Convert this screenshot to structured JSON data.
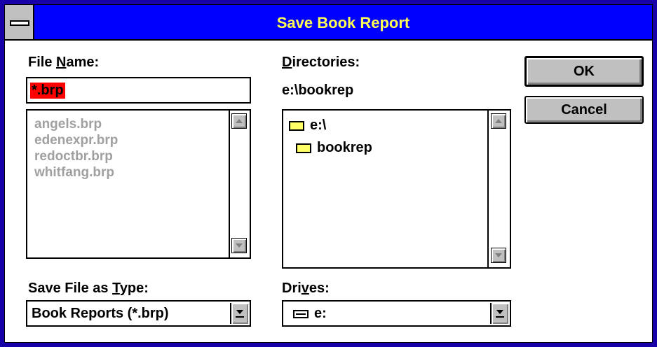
{
  "window": {
    "title": "Save Book Report"
  },
  "file_name": {
    "label_pre": "File ",
    "label_ul": "N",
    "label_post": "ame:",
    "value": "*.brp",
    "files": [
      "angels.brp",
      "edenexpr.brp",
      "redoctbr.brp",
      "whitfang.brp"
    ]
  },
  "directories": {
    "label_ul": "D",
    "label_post": "irectories:",
    "current_path": "e:\\bookrep",
    "items": [
      "e:\\",
      "bookrep"
    ]
  },
  "buttons": {
    "ok": "OK",
    "cancel": "Cancel"
  },
  "save_type": {
    "label_pre": "Save File as ",
    "label_ul": "T",
    "label_post": "ype:",
    "value": "Book Reports (*.brp)"
  },
  "drives": {
    "label_pre": "Dri",
    "label_ul": "v",
    "label_post": "es:",
    "value": "e:"
  },
  "icons": [
    "system-menu-icon",
    "folder-open-icon",
    "drive-icon",
    "scroll-up-arrow-icon",
    "scroll-down-arrow-icon",
    "dropdown-arrow-icon"
  ],
  "colors": {
    "titlebar": "#0000ff",
    "title_text": "#ffff55",
    "selection": "#ff0000",
    "frame": "#1800a8",
    "disabled_text": "#a0a0a0"
  }
}
